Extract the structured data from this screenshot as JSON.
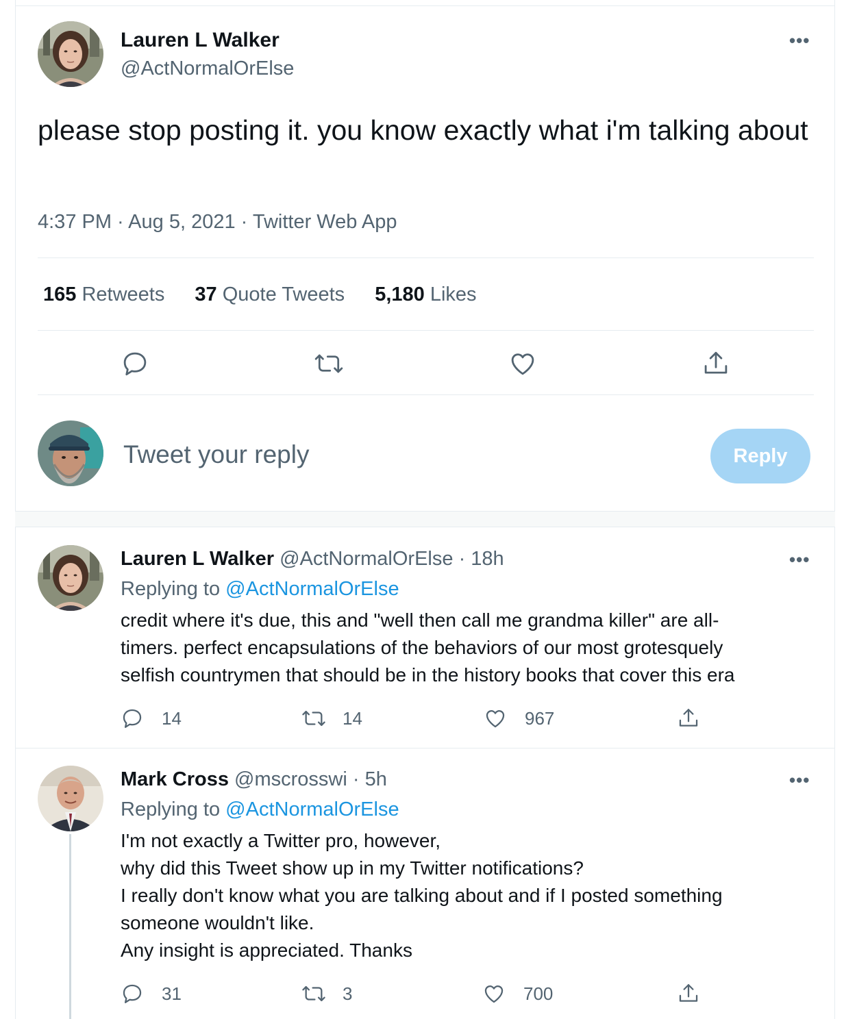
{
  "main_tweet": {
    "author_name": "Lauren L Walker",
    "author_handle": "@ActNormalOrElse",
    "text": "please stop posting it. you know exactly what i'm talking about",
    "meta": "4:37 PM · Aug 5, 2021 · Twitter Web App",
    "stats": {
      "retweets_count": "165",
      "retweets_label": "Retweets",
      "quotes_count": "37",
      "quotes_label": "Quote Tweets",
      "likes_count": "5,180",
      "likes_label": "Likes"
    }
  },
  "reply_composer": {
    "placeholder": "Tweet your reply",
    "button_label": "Reply"
  },
  "replies": [
    {
      "author_name": "Lauren L Walker",
      "author_handle": "@ActNormalOrElse",
      "time": "· 18h",
      "replying_prefix": "Replying to",
      "replying_to": "@ActNormalOrElse",
      "text_lines": [
        "credit where it's due, this and \"well then call me grandma killer\" are all-",
        "timers. perfect encapsulations of the behaviors of our most grotesquely",
        "selfish countrymen that should be in the history books that cover this era"
      ],
      "reply_count": "14",
      "retweet_count": "14",
      "like_count": "967"
    },
    {
      "author_name": "Mark Cross",
      "author_handle": "@mscrosswi",
      "time": "· 5h",
      "replying_prefix": "Replying to",
      "replying_to": "@ActNormalOrElse",
      "text_lines": [
        "I'm not exactly a Twitter pro, however,",
        "why did this Tweet show up in my Twitter notifications?",
        "I really don't know what you are talking about and if I posted something",
        "someone wouldn't like.",
        "Any insight is appreciated. Thanks"
      ],
      "reply_count": "31",
      "retweet_count": "3",
      "like_count": "700"
    }
  ],
  "colors": {
    "accent": "#1b95e0",
    "reply_button_disabled": "#a5d5f5",
    "secondary_text": "#536471",
    "divider": "#e6ecf0"
  },
  "icons": [
    "more-icon",
    "reply-icon",
    "retweet-icon",
    "like-icon",
    "share-icon"
  ]
}
